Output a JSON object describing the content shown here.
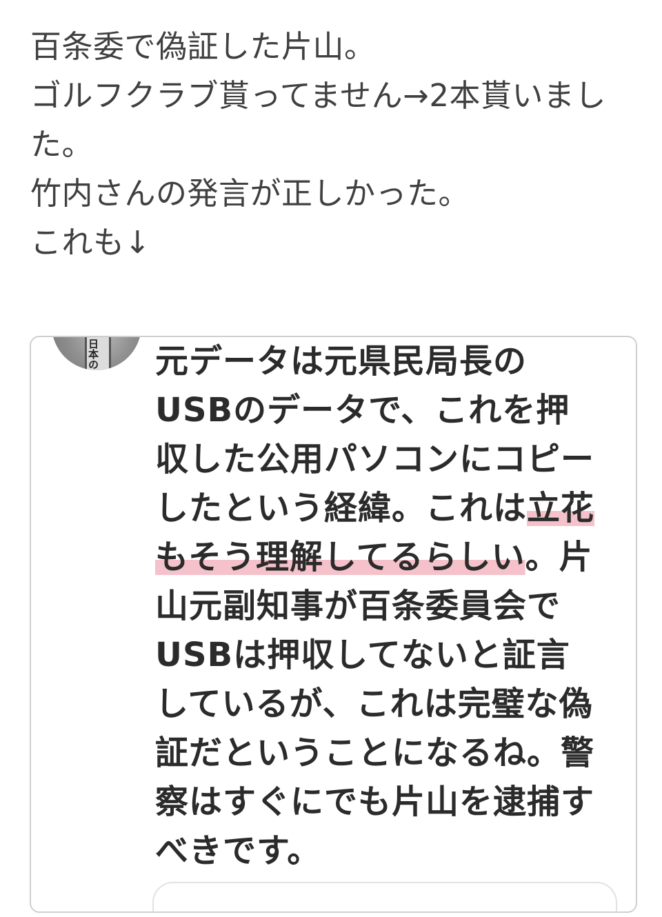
{
  "post": {
    "lines": [
      "百条委で偽証した片山。",
      "ゴルフクラブ貰ってません→2本貰いまし",
      "た。",
      "竹内さんの発言が正しかった。",
      "これも↓"
    ]
  },
  "embed": {
    "avatar": {
      "icon": "book-cover-avatar-icon",
      "glyph_text": "日本の"
    },
    "lines": [
      {
        "before": "元データは元県民局長の",
        "highlight": "",
        "after": ""
      },
      {
        "before": "USBのデータで、これを押",
        "highlight": "",
        "after": ""
      },
      {
        "before": "収した公用パソコンにコピー",
        "highlight": "",
        "after": ""
      },
      {
        "before": "したという経緯。これは",
        "highlight": "立花",
        "after": ""
      },
      {
        "before": "",
        "highlight": "もそう理解してるらしい",
        "after": "。片"
      },
      {
        "before": "山元副知事が百条委員会で",
        "highlight": "",
        "after": ""
      },
      {
        "before": "USBは押収してないと証言",
        "highlight": "",
        "after": ""
      },
      {
        "before": "しているが、これは完璧な偽",
        "highlight": "",
        "after": ""
      },
      {
        "before": "証だということになるね。警",
        "highlight": "",
        "after": ""
      },
      {
        "before": "察はすぐにでも片山を逮捕す",
        "highlight": "",
        "after": ""
      },
      {
        "before": "べきです。",
        "highlight": "",
        "after": ""
      }
    ],
    "highlight_color": "#f4b9c4"
  }
}
